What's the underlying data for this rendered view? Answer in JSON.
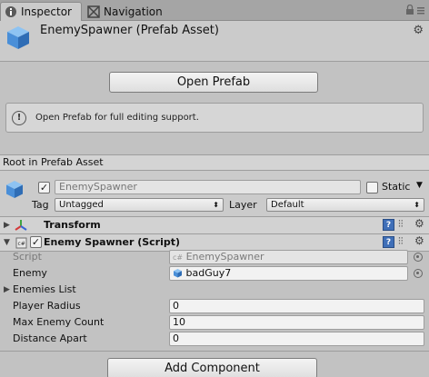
{
  "tabs": [
    {
      "label": "Inspector",
      "icon": "inspector-icon"
    },
    {
      "label": "Navigation",
      "icon": "navigation-icon"
    }
  ],
  "header": {
    "title": "EnemySpawner (Prefab Asset)"
  },
  "open_prefab_button": "Open Prefab",
  "help": {
    "text": "Open Prefab for full editing support."
  },
  "root_label": "Root in Prefab Asset",
  "gameobject": {
    "active": true,
    "name": "EnemySpawner",
    "static_label": "Static",
    "static": false,
    "tag_label": "Tag",
    "tag_value": "Untagged",
    "layer_label": "Layer",
    "layer_value": "Default"
  },
  "components": {
    "transform": {
      "title": "Transform"
    },
    "spawner": {
      "title": "Enemy Spawner (Script)",
      "enabled": true
    }
  },
  "properties": {
    "script": {
      "label": "Script",
      "value": "EnemySpawner"
    },
    "enemy": {
      "label": "Enemy",
      "value": "badGuy7"
    },
    "enemies_list": {
      "label": "Enemies List"
    },
    "player_radius": {
      "label": "Player Radius",
      "value": "0"
    },
    "max_enemy_count": {
      "label": "Max Enemy Count",
      "value": "10"
    },
    "distance_apart": {
      "label": "Distance Apart",
      "value": "0"
    }
  },
  "add_component_button": "Add Component",
  "colors": {
    "accent_blue": "#3f6fb8",
    "cube_blue": "#4a8fd8"
  }
}
